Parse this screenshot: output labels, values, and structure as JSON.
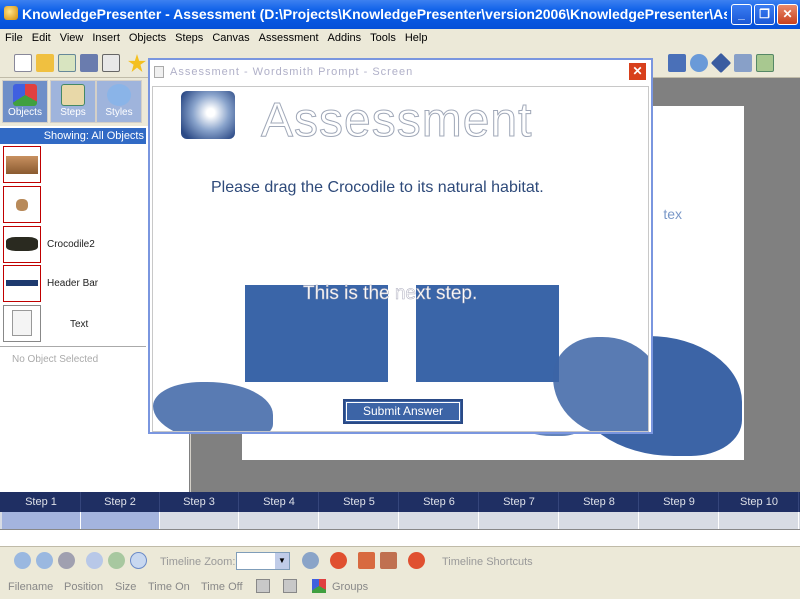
{
  "window": {
    "title": "KnowledgePresenter - Assessment (D:\\Projects\\KnowledgePresenter\\version2006\\KnowledgePresenter\\Assessm...",
    "minimize": "_",
    "restore": "❐",
    "close": "✕"
  },
  "menu": [
    "File",
    "Edit",
    "View",
    "Insert",
    "Objects",
    "Steps",
    "Canvas",
    "Assessment",
    "Addins",
    "Tools",
    "Help"
  ],
  "left_panel": {
    "tabs": [
      "Objects",
      "Steps",
      "Styles"
    ],
    "showing": "Showing: All Objects",
    "objects": [
      {
        "label": ""
      },
      {
        "label": ""
      },
      {
        "label": "Crocodile2"
      },
      {
        "label": "Header Bar"
      },
      {
        "label": "Text"
      }
    ],
    "no_object": "No Object Selected"
  },
  "background_slide": {
    "partial_text": "tex"
  },
  "dialog": {
    "title": "Assessment - Wordsmith Prompt - Screen",
    "close": "✕",
    "heading": "Assessment",
    "question": "Please drag the Crocodile to its natural habitat.",
    "next_step": "This is the next step.",
    "submit": "Submit Answer"
  },
  "timeline": {
    "steps": [
      "Step 1",
      "Step 2",
      "Step 3",
      "Step 4",
      "Step 5",
      "Step 6",
      "Step 7",
      "Step 8",
      "Step 9",
      "Step 10"
    ],
    "zoom_label": "Timeline Zoom:",
    "shortcuts": "Timeline Shortcuts"
  },
  "status": {
    "columns": [
      "Filename",
      "Position",
      "Size",
      "Time On",
      "Time Off",
      "Groups"
    ]
  },
  "colors": {
    "title_bar": "#0a5ee8",
    "selection": "#316ac5",
    "accent_blue": "#3c64a6",
    "close_red": "#d8401c"
  }
}
